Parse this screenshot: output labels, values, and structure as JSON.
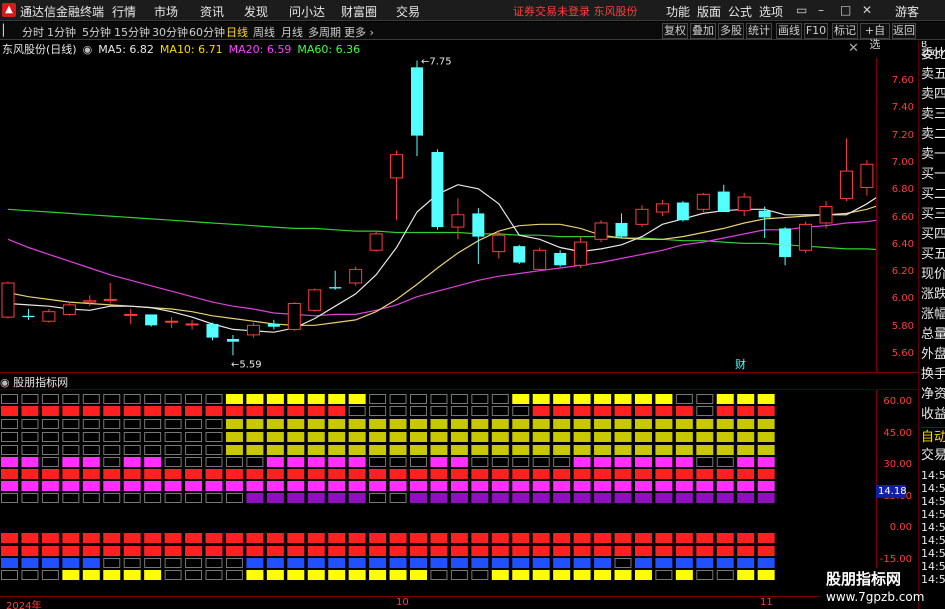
{
  "app": {
    "title": "通达信金融终端",
    "menu": [
      "行情",
      "市场",
      "资讯",
      "发现",
      "问小达",
      "财富圈",
      "交易"
    ],
    "notice": "证券交易未登录  东风股份",
    "right_menu": [
      "功能",
      "版面",
      "公式",
      "选项"
    ],
    "user": "游客"
  },
  "toolbar": {
    "periods": [
      "分时",
      "1分钟",
      "5分钟",
      "15分钟",
      "30分钟",
      "60分钟",
      "日线",
      "周线",
      "月线",
      "多周期",
      "更多"
    ],
    "active_period": "日线",
    "right_buttons": [
      "复权",
      "叠加",
      "多股",
      "统计",
      "画线",
      "F10",
      "标记",
      "+自选",
      "返回"
    ]
  },
  "chart": {
    "stock_label": "东风股份(日线)",
    "ma": [
      {
        "label": "MA5: 6.82",
        "color": "#e8e8e8"
      },
      {
        "label": "MA10: 6.71",
        "color": "#ffd700"
      },
      {
        "label": "MA20: 6.59",
        "color": "#ff40ff"
      },
      {
        "label": "MA60: 6.36",
        "color": "#40ff40"
      }
    ],
    "high_label": "7.75",
    "low_label": "5.59",
    "fin_marker": "财",
    "price_ticks": [
      "7.60",
      "7.40",
      "7.20",
      "7.00",
      "6.80",
      "6.60",
      "6.40",
      "6.20",
      "6.00",
      "5.80",
      "5.60"
    ],
    "indicator_title": "股朋指标网",
    "indicator_ticks": [
      "60.00",
      "45.00",
      "30.00",
      "15.00",
      "0.00",
      "-15.00"
    ],
    "indicator_current": "14.18",
    "x_ticks": [
      "2024年",
      "10",
      "11"
    ]
  },
  "chart_data": {
    "type": "candlestick",
    "title": "东风股份(日线)",
    "ylim": [
      5.5,
      7.85
    ],
    "candles": [
      {
        "o": 5.87,
        "h": 6.13,
        "l": 5.86,
        "c": 6.12
      },
      {
        "o": 5.88,
        "h": 5.93,
        "l": 5.85,
        "c": 5.87
      },
      {
        "o": 5.84,
        "h": 5.93,
        "l": 5.83,
        "c": 5.91
      },
      {
        "o": 5.89,
        "h": 5.98,
        "l": 5.88,
        "c": 5.96
      },
      {
        "o": 5.98,
        "h": 6.03,
        "l": 5.95,
        "c": 5.99
      },
      {
        "o": 6.0,
        "h": 6.12,
        "l": 5.97,
        "c": 6.0
      },
      {
        "o": 5.89,
        "h": 5.93,
        "l": 5.82,
        "c": 5.89
      },
      {
        "o": 5.89,
        "h": 5.88,
        "l": 5.8,
        "c": 5.81
      },
      {
        "o": 5.84,
        "h": 5.87,
        "l": 5.79,
        "c": 5.84
      },
      {
        "o": 5.82,
        "h": 5.85,
        "l": 5.78,
        "c": 5.82
      },
      {
        "o": 5.82,
        "h": 5.83,
        "l": 5.7,
        "c": 5.72
      },
      {
        "o": 5.71,
        "h": 5.74,
        "l": 5.59,
        "c": 5.69
      },
      {
        "o": 5.74,
        "h": 5.83,
        "l": 5.72,
        "c": 5.81
      },
      {
        "o": 5.82,
        "h": 5.85,
        "l": 5.78,
        "c": 5.8
      },
      {
        "o": 5.78,
        "h": 5.98,
        "l": 5.77,
        "c": 5.97
      },
      {
        "o": 5.92,
        "h": 6.08,
        "l": 5.91,
        "c": 6.07
      },
      {
        "o": 6.09,
        "h": 6.21,
        "l": 6.07,
        "c": 6.08
      },
      {
        "o": 6.12,
        "h": 6.24,
        "l": 6.1,
        "c": 6.22
      },
      {
        "o": 6.36,
        "h": 6.5,
        "l": 6.35,
        "c": 6.48
      },
      {
        "o": 6.89,
        "h": 7.09,
        "l": 6.58,
        "c": 7.06
      },
      {
        "o": 7.7,
        "h": 7.75,
        "l": 7.05,
        "c": 7.2
      },
      {
        "o": 7.08,
        "h": 7.1,
        "l": 6.51,
        "c": 6.53
      },
      {
        "o": 6.53,
        "h": 6.74,
        "l": 6.44,
        "c": 6.62
      },
      {
        "o": 6.63,
        "h": 6.67,
        "l": 6.26,
        "c": 6.46
      },
      {
        "o": 6.35,
        "h": 6.5,
        "l": 6.3,
        "c": 6.47
      },
      {
        "o": 6.39,
        "h": 6.4,
        "l": 6.26,
        "c": 6.27
      },
      {
        "o": 6.22,
        "h": 6.38,
        "l": 6.21,
        "c": 6.36
      },
      {
        "o": 6.34,
        "h": 6.36,
        "l": 6.24,
        "c": 6.25
      },
      {
        "o": 6.25,
        "h": 6.46,
        "l": 6.23,
        "c": 6.42
      },
      {
        "o": 6.44,
        "h": 6.58,
        "l": 6.42,
        "c": 6.56
      },
      {
        "o": 6.56,
        "h": 6.63,
        "l": 6.45,
        "c": 6.46
      },
      {
        "o": 6.55,
        "h": 6.69,
        "l": 6.53,
        "c": 6.66
      },
      {
        "o": 6.64,
        "h": 6.73,
        "l": 6.61,
        "c": 6.7
      },
      {
        "o": 6.71,
        "h": 6.72,
        "l": 6.57,
        "c": 6.58
      },
      {
        "o": 6.66,
        "h": 6.78,
        "l": 6.64,
        "c": 6.77
      },
      {
        "o": 6.79,
        "h": 6.84,
        "l": 6.64,
        "c": 6.64
      },
      {
        "o": 6.65,
        "h": 6.78,
        "l": 6.61,
        "c": 6.75
      },
      {
        "o": 6.65,
        "h": 6.68,
        "l": 6.45,
        "c": 6.6
      },
      {
        "o": 6.52,
        "h": 6.53,
        "l": 6.25,
        "c": 6.31
      },
      {
        "o": 6.36,
        "h": 6.57,
        "l": 6.34,
        "c": 6.55
      },
      {
        "o": 6.56,
        "h": 6.72,
        "l": 6.52,
        "c": 6.68
      },
      {
        "o": 6.74,
        "h": 7.18,
        "l": 6.72,
        "c": 6.94
      },
      {
        "o": 6.82,
        "h": 7.02,
        "l": 6.76,
        "c": 6.99
      },
      {
        "o": 7.08,
        "h": 7.09,
        "l": 6.89,
        "c": 6.9
      }
    ],
    "ma5": [
      5.97,
      5.96,
      5.95,
      5.93,
      5.92,
      5.95,
      5.95,
      5.94,
      5.91,
      5.87,
      5.82,
      5.78,
      5.77,
      5.76,
      5.79,
      5.86,
      5.95,
      6.04,
      6.18,
      6.38,
      6.64,
      6.77,
      6.84,
      6.81,
      6.7,
      6.47,
      6.44,
      6.38,
      6.35,
      6.37,
      6.4,
      6.46,
      6.55,
      6.59,
      6.63,
      6.65,
      6.66,
      6.66,
      6.62,
      6.62,
      6.62,
      6.62,
      6.7,
      6.8
    ],
    "ma10": [
      6.05,
      6.02,
      6.0,
      5.98,
      5.97,
      5.96,
      5.95,
      5.94,
      5.93,
      5.91,
      5.88,
      5.86,
      5.84,
      5.82,
      5.81,
      5.81,
      5.83,
      5.85,
      5.91,
      6.0,
      6.11,
      6.23,
      6.34,
      6.43,
      6.5,
      6.54,
      6.55,
      6.55,
      6.52,
      6.47,
      6.45,
      6.44,
      6.44,
      6.46,
      6.49,
      6.52,
      6.56,
      6.59,
      6.6,
      6.61,
      6.62,
      6.63,
      6.66,
      6.71
    ],
    "ma20": [
      6.44,
      6.38,
      6.33,
      6.28,
      6.23,
      6.18,
      6.14,
      6.1,
      6.06,
      6.02,
      5.98,
      5.95,
      5.93,
      5.9,
      5.89,
      5.88,
      5.89,
      5.89,
      5.92,
      5.96,
      6.02,
      6.06,
      6.1,
      6.14,
      6.17,
      6.19,
      6.21,
      6.23,
      6.25,
      6.27,
      6.3,
      6.33,
      6.36,
      6.4,
      6.42,
      6.45,
      6.48,
      6.51,
      6.51,
      6.53,
      6.54,
      6.56,
      6.57,
      6.59
    ],
    "ma60": [
      6.66,
      6.65,
      6.64,
      6.63,
      6.62,
      6.61,
      6.6,
      6.59,
      6.58,
      6.57,
      6.56,
      6.55,
      6.54,
      6.53,
      6.52,
      6.52,
      6.51,
      6.5,
      6.5,
      6.49,
      6.49,
      6.49,
      6.49,
      6.48,
      6.48,
      6.47,
      6.47,
      6.46,
      6.46,
      6.46,
      6.45,
      6.45,
      6.44,
      6.43,
      6.43,
      6.42,
      6.41,
      6.41,
      6.4,
      6.39,
      6.38,
      6.37,
      6.37,
      6.36
    ],
    "indicator": {
      "ylim": [
        -20,
        65
      ],
      "row_colors": [
        "#ffff00",
        "#ff2020",
        "#c8c800",
        "#c8c800",
        "#c8c800",
        "#ff30ff",
        "#ff2020",
        "#ff30ff",
        "#9010c0",
        "#ff2020",
        "#ff2020",
        "#2050ff",
        "#ffff00"
      ],
      "rows": [
        "00000000000111111100000001111111100111",
        "11111111111111111000000000111111110111",
        "00000000000111111111111111111111111111",
        "00000000000111111111111111111111111111",
        "00000000000111111111111111111111111111",
        "11011011000001111100011000001111110011",
        "11111111111111111111111111111111111111",
        "11111111111111111111111111111111111111",
        "00000000000011111100111111111111111111",
        "11111111111111111111111111111111111111",
        "11111111111111111111111111111111111111",
        "11111000000011111111111111111101111111",
        "00011111000011111111100011111111010011"
      ]
    }
  }
}
